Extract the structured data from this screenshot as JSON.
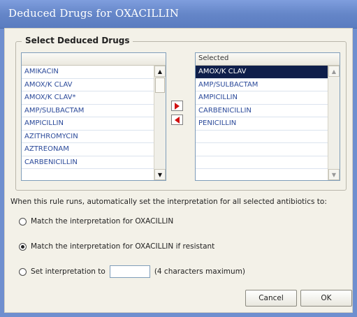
{
  "window": {
    "title": "Deduced Drugs for OXACILLIN"
  },
  "group": {
    "title": "Select Deduced Drugs"
  },
  "available": {
    "header": "",
    "items": [
      "AMIKACIN",
      "AMOX/K CLAV",
      "AMOX/K CLAV*",
      "AMP/SULBACTAM",
      "AMPICILLIN",
      "AZITHROMYCIN",
      "AZTREONAM",
      "CARBENICILLIN"
    ]
  },
  "selected": {
    "header": "Selected",
    "items": [
      "AMOX/K CLAV",
      "AMP/SULBACTAM",
      "AMPICILLIN",
      "CARBENICILLIN",
      "PENICILLIN",
      "",
      "",
      ""
    ]
  },
  "instruction": "When this rule runs, automatically set the interpretation for all selected antibiotics to:",
  "options": {
    "match": "Match the interpretation for OXACILLIN",
    "match_resistant": "Match the interpretation for OXACILLIN if resistant",
    "set_prefix": "Set interpretation to",
    "set_suffix": "(4 characters maximum)",
    "set_value": ""
  },
  "buttons": {
    "cancel": "Cancel",
    "ok": "OK"
  },
  "colors": {
    "title_bar": "#6586c8",
    "list_text": "#2b4a9a",
    "selection": "#0e1e4a",
    "arrow": "#d01010"
  }
}
